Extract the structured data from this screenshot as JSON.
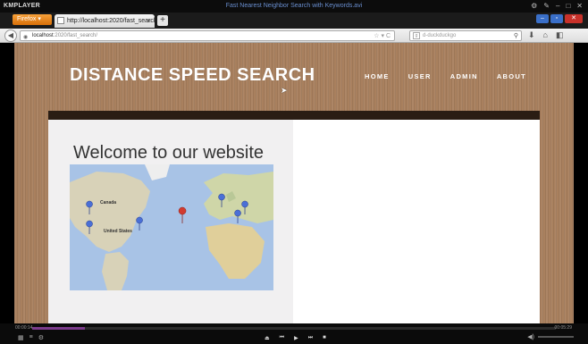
{
  "player": {
    "logo": "KMPLAYER",
    "title": "Fast Nearest Neighbor Search with Keywords.avi",
    "time_elapsed": "00:00:14",
    "time_total": "00:05:29",
    "progress": 0.1
  },
  "browser": {
    "menu_button": "Firefox",
    "tab_title": "http://localhost:2020/fast_search/",
    "url_host": "localhost",
    "url_path": ":2020/fast_search/",
    "search_placeholder": "d-duckduckgo",
    "search_engine_glyph": "g"
  },
  "site": {
    "title": "DISTANCE SPEED SEARCH",
    "nav": [
      "HOME",
      "USER",
      "ADMIN",
      "ABOUT"
    ],
    "welcome": "Welcome to our website",
    "map_labels": [
      "Canada",
      "United States"
    ]
  },
  "colors": {
    "wood": "#a9805e",
    "dark_strip": "#2a1d14",
    "panel": "#f1f0f1",
    "seek_fill": "#7b3b8c"
  }
}
